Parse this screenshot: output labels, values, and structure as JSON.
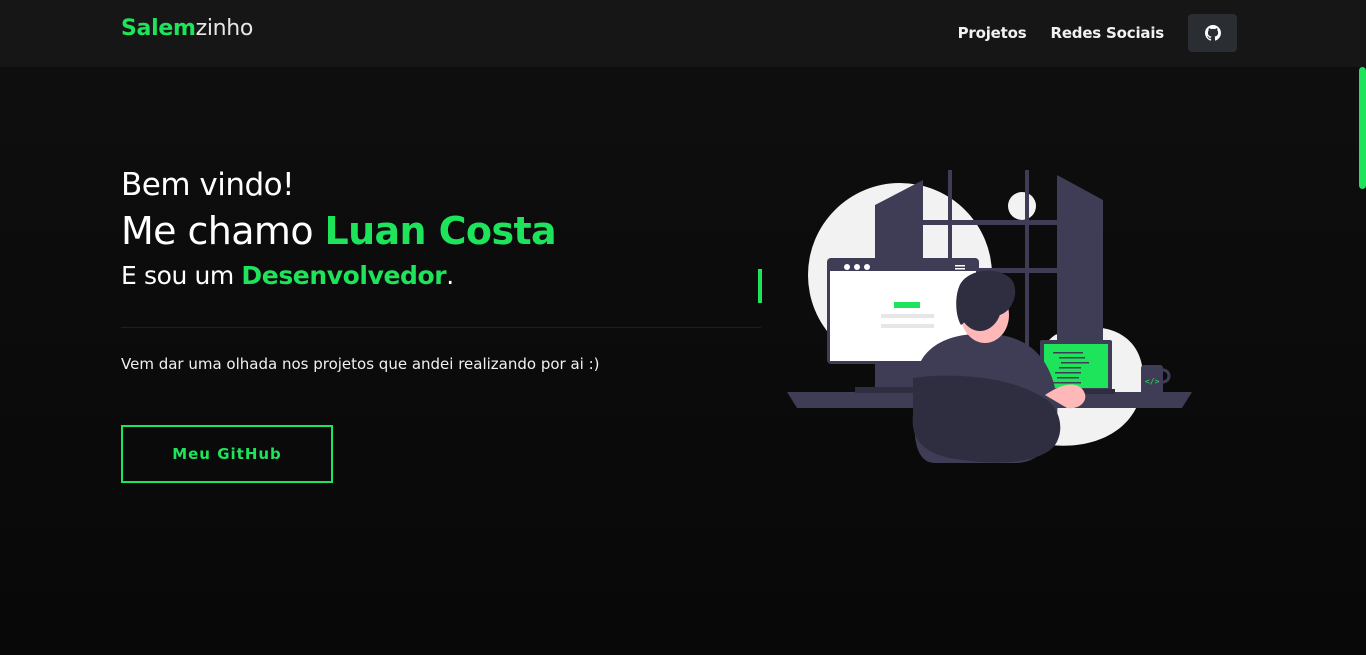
{
  "brand": {
    "accent": "Salem",
    "rest": "zinho"
  },
  "nav": {
    "items": [
      "Projetos",
      "Redes Sociais"
    ],
    "github_icon": "github-icon"
  },
  "hero": {
    "greeting": "Bem vindo!",
    "name_prefix": "Me chamo ",
    "name": "Luan Costa",
    "role_prefix": "E sou um ",
    "role": "Desenvolvedor",
    "role_suffix": ".",
    "tagline": "Vem dar uma olhada nos projetos que andei realizando por ai :)",
    "cta_label": "Meu GitHub"
  },
  "colors": {
    "accent": "#1ee45b",
    "background": "#0a0a0a",
    "navbar": "#161616"
  }
}
